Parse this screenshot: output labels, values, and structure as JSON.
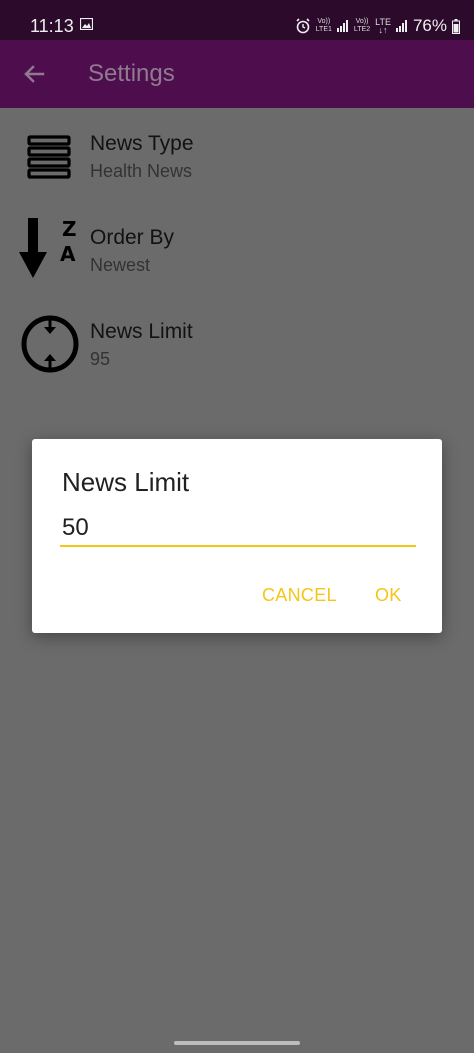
{
  "status_bar": {
    "time": "11:13",
    "sim1_label_top": "Vo))",
    "sim1_label_bottom": "LTE1",
    "sim2_label_top": "Vo))",
    "sim2_label_bottom": "LTE2",
    "lte_label": "LTE",
    "battery": "76%",
    "icons": [
      "gallery-icon",
      "alarm-icon",
      "signal-icon",
      "battery-icon"
    ]
  },
  "app_bar": {
    "title": "Settings",
    "back_icon": "arrow-left-icon"
  },
  "settings": [
    {
      "title": "News Type",
      "summary": "Health News",
      "icon": "list-lines-icon"
    },
    {
      "title": "Order By",
      "summary": "Newest",
      "icon": "sort-z-a-icon"
    },
    {
      "title": "News Limit",
      "summary": "95",
      "icon": "limit-circle-icon"
    }
  ],
  "dialog": {
    "title": "News Limit",
    "input_value": "50",
    "cancel_label": "CANCEL",
    "ok_label": "OK"
  },
  "colors": {
    "status_bar": "#2b0a2b",
    "app_bar": "#4e0e4e",
    "scrim_background": "#6b6b6b",
    "accent": "#f5c518"
  }
}
